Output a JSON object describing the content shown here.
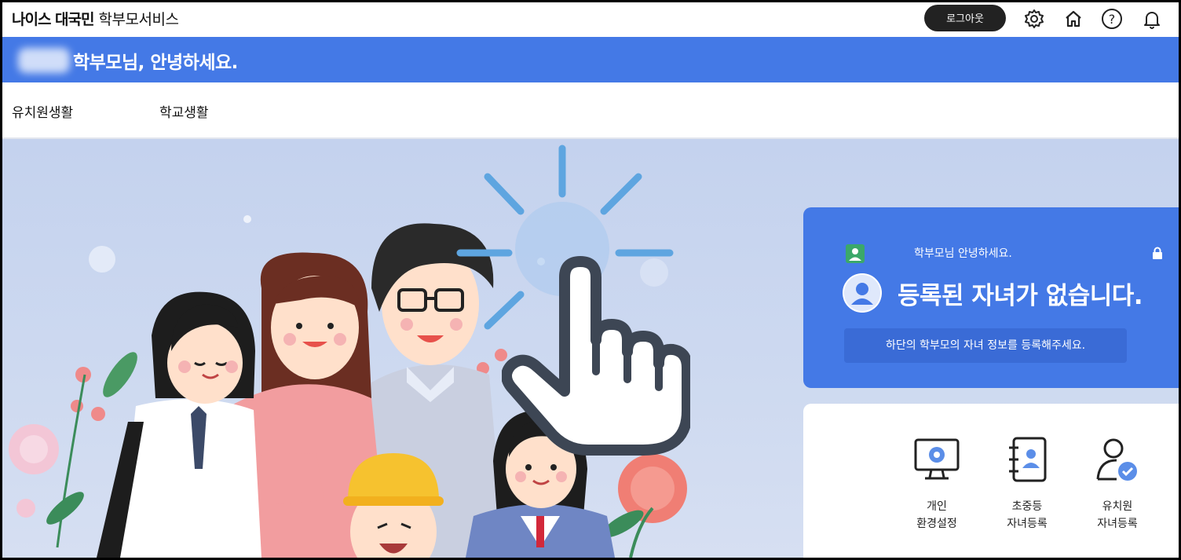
{
  "header": {
    "brand_bold": "나이스 대국민",
    "brand_rest": "학부모서비스",
    "logout_label": "로그아웃",
    "icons": [
      "gear-icon",
      "home-icon",
      "help-icon",
      "bell-icon"
    ]
  },
  "greeting": {
    "text": "학부모님, 안녕하세요."
  },
  "nav": {
    "items": [
      {
        "label": "유치원생활"
      },
      {
        "label": "학교생활"
      }
    ]
  },
  "status_card": {
    "small_text": "학부모님 안녕하세요.",
    "title": "등록된 자녀가 없습니다.",
    "notice": "하단의 학부모의 자녀 정보를 등록해주세요."
  },
  "quick_menu": [
    {
      "label": "개인\n환경설정",
      "icon": "monitor-gear-icon"
    },
    {
      "label": "초중등\n자녀등록",
      "icon": "contact-book-icon"
    },
    {
      "label": "유치원\n자녀등록",
      "icon": "user-check-icon"
    }
  ],
  "colors": {
    "primary": "#4479e6",
    "hero_bg": "#c4d2ee",
    "logout_bg": "#222222",
    "cursor_rays": "#5ea5e0"
  }
}
